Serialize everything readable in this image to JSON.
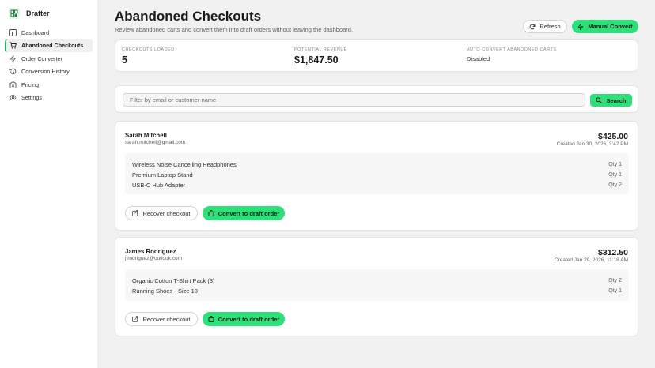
{
  "app": {
    "name": "Drafter"
  },
  "sidebar": {
    "items": [
      {
        "label": "Dashboard",
        "icon": "dashboard-icon"
      },
      {
        "label": "Abandoned Checkouts",
        "icon": "cart-icon",
        "active": true
      },
      {
        "label": "Order Converter",
        "icon": "bolt-icon"
      },
      {
        "label": "Conversion History",
        "icon": "history-icon"
      },
      {
        "label": "Pricing",
        "icon": "pricing-icon"
      },
      {
        "label": "Settings",
        "icon": "gear-icon"
      }
    ]
  },
  "header": {
    "title": "Abandoned Checkouts",
    "subtitle": "Review abandoned carts and convert them into draft orders without leaving the dashboard.",
    "refresh_label": "Refresh",
    "manual_convert_label": "Manual Convert"
  },
  "stats": {
    "checkouts_loaded_label": "CHECKOUTS LOADED",
    "checkouts_loaded_value": "5",
    "potential_revenue_label": "POTENTIAL REVENUE",
    "potential_revenue_value": "$1,847.50",
    "auto_convert_label": "AUTO CONVERT ABANDONED CARTS",
    "auto_convert_value": "Disabled"
  },
  "search": {
    "placeholder": "Filter by email or customer name",
    "value": "",
    "button_label": "Search"
  },
  "checkouts": [
    {
      "name": "Sarah Mitchell",
      "email": "sarah.mitchell@gmail.com",
      "total": "$425.00",
      "created": "Created Jan 30, 2026, 3:42 PM",
      "items": [
        {
          "title": "Wireless Noise Cancelling Headphones",
          "qty": "Qty 1"
        },
        {
          "title": "Premium Laptop Stand",
          "qty": "Qty 1"
        },
        {
          "title": "USB-C Hub Adapter",
          "qty": "Qty 2"
        }
      ],
      "recover_label": "Recover checkout",
      "convert_label": "Convert to draft order"
    },
    {
      "name": "James Rodriguez",
      "email": "j.rodriguez@outlook.com",
      "total": "$312.50",
      "created": "Created Jan 29, 2026, 11:18 AM",
      "items": [
        {
          "title": "Organic Cotton T-Shirt Pack (3)",
          "qty": "Qty 2"
        },
        {
          "title": "Running Shoes - Size 10",
          "qty": "Qty 1"
        }
      ],
      "recover_label": "Recover checkout",
      "convert_label": "Convert to draft order"
    }
  ],
  "colors": {
    "accent": "#2ee07a",
    "sidebar_active_border": "#2bb35f",
    "background": "#f1f1f1"
  }
}
